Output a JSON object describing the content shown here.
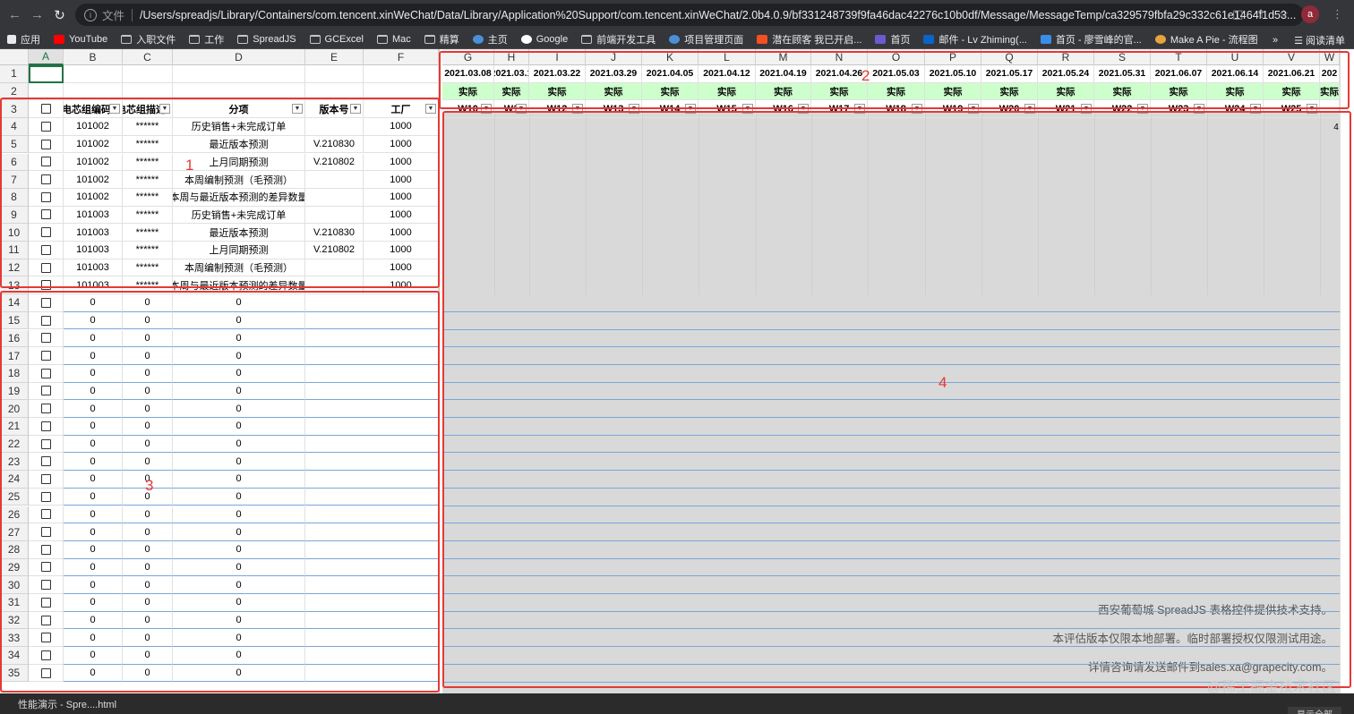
{
  "browser": {
    "scheme_label": "文件",
    "url": "/Users/spreadjs/Library/Containers/com.tencent.xinWeChat/Data/Library/Application%20Support/com.tencent.xinWeChat/2.0b4.0.9/bf331248739f9fa46dac42276c10b0df/Message/MessageTemp/ca329579fbfa29c332c61e1464f1d53...",
    "avatar_letter": "a",
    "bookmarks": [
      "应用",
      "YouTube",
      "入职文件",
      "工作",
      "SpreadJS",
      "GCExcel",
      "Mac",
      "精算",
      "主页",
      "Google",
      "前端开发工具",
      "项目管理页面",
      "潜在顾客 我已开启...",
      "首页",
      "邮件 - Lv Zhiming(...",
      "首页 - 廖雪峰的官...",
      "Make A Pie - 流程图"
    ],
    "reading_list": "阅读清单"
  },
  "sheet": {
    "left_columns": [
      "A",
      "B",
      "C",
      "D",
      "E",
      "F"
    ],
    "right_columns": [
      "G",
      "H",
      "I",
      "J",
      "K",
      "L",
      "M",
      "N",
      "O",
      "P",
      "Q",
      "R",
      "S",
      "T",
      "U",
      "V",
      "W"
    ],
    "header_row": {
      "b": "电芯组编码",
      "c": "电芯组描述",
      "d": "分项",
      "e": "版本号",
      "f": "工厂"
    },
    "rows": [
      {
        "num": "4",
        "b": "101002",
        "c": "******",
        "d": "历史销售+未完成订单",
        "e": "",
        "f": "1000"
      },
      {
        "num": "5",
        "b": "101002",
        "c": "******",
        "d": "最近版本预测",
        "e": "V.210830",
        "f": "1000"
      },
      {
        "num": "6",
        "b": "101002",
        "c": "******",
        "d": "上月同期预测",
        "e": "V.210802",
        "f": "1000"
      },
      {
        "num": "7",
        "b": "101002",
        "c": "******",
        "d": "本周编制预测（毛预测）",
        "e": "",
        "f": "1000"
      },
      {
        "num": "8",
        "b": "101002",
        "c": "******",
        "d": "本周与最近版本预测的差异数量",
        "e": "",
        "f": "1000"
      },
      {
        "num": "9",
        "b": "101003",
        "c": "******",
        "d": "历史销售+未完成订单",
        "e": "",
        "f": "1000"
      },
      {
        "num": "10",
        "b": "101003",
        "c": "******",
        "d": "最近版本预测",
        "e": "V.210830",
        "f": "1000"
      },
      {
        "num": "11",
        "b": "101003",
        "c": "******",
        "d": "上月同期预测",
        "e": "V.210802",
        "f": "1000"
      },
      {
        "num": "12",
        "b": "101003",
        "c": "******",
        "d": "本周编制预测（毛预测）",
        "e": "",
        "f": "1000"
      },
      {
        "num": "13",
        "b": "101003",
        "c": "******",
        "d": "本周与最近版本预测的差异数量",
        "e": "",
        "f": "1000"
      }
    ],
    "dates": [
      "2021.03.08",
      "2021.03.1",
      "2021.03.22",
      "2021.03.29",
      "2021.04.05",
      "2021.04.12",
      "2021.04.19",
      "2021.04.26",
      "2021.05.03",
      "2021.05.10",
      "2021.05.17",
      "2021.05.24",
      "2021.05.31",
      "2021.06.07",
      "2021.06.14",
      "2021.06.21",
      "202"
    ],
    "actual_label": "实际",
    "weeks": [
      "W10",
      "W1",
      "W12",
      "W13",
      "W14",
      "W15",
      "W16",
      "W17",
      "W18",
      "W19",
      "W20",
      "W21",
      "W22",
      "W23",
      "W24",
      "W25",
      ""
    ],
    "zero_rows": [
      "14",
      "15",
      "16",
      "17",
      "18",
      "19",
      "20",
      "21",
      "22",
      "23",
      "24",
      "25",
      "26",
      "27",
      "28",
      "29",
      "30",
      "31",
      "32",
      "33",
      "34",
      "35"
    ],
    "zero_value": "0",
    "row_numbers_top": [
      "1",
      "2",
      "3"
    ],
    "corner_value": "4",
    "license": [
      "西安葡萄城 SpreadJS 表格控件提供技术支持。",
      "本评估版本仅限本地部署。临时部署授权仅限测试用途。",
      "详情咨询请发送邮件到sales.xa@grapecity.com。"
    ]
  },
  "annotations": [
    "1",
    "2",
    "3",
    "4"
  ],
  "footer": {
    "tab_label": "性能演示 - Spre....html",
    "download_label": "显示全部",
    "watermark": "@稀土掘金技术社区"
  }
}
